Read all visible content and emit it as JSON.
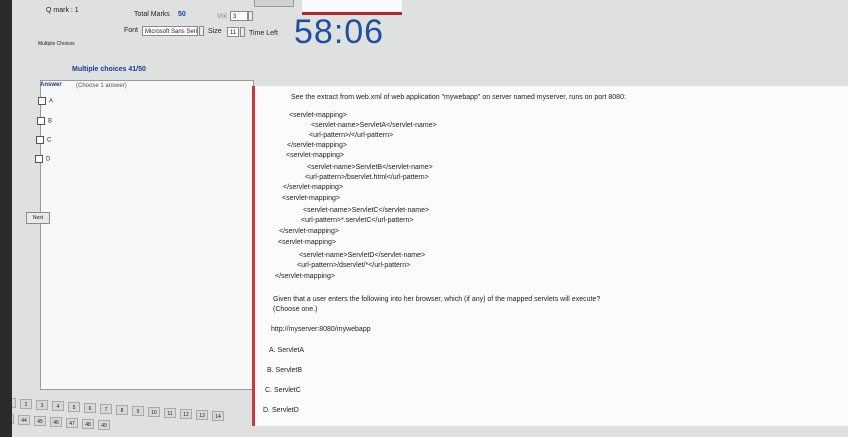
{
  "header": {
    "q_mark_label": "Q mark : 1",
    "total_marks_label": "Total Marks",
    "total_marks_value": "50",
    "vol_label": "Vol",
    "vol_value": "3",
    "font_label": "Font",
    "font_value": "Microsoft Sans Serif",
    "size_label": "Size",
    "size_value": "11",
    "time_left_label": "Time Left",
    "timer": "58:06",
    "mode_label": "Multiple Choices"
  },
  "question_panel_title": "Multiple choices 41/50",
  "answers": {
    "header": "Answer",
    "hint": "(Choose 1 answer)",
    "options": [
      "A",
      "B",
      "C",
      "D"
    ],
    "next_label": "Next"
  },
  "question": {
    "intro": "See the extract from web.xml of web application \"mywebapp\" on server named myserver, runs on port 8080:",
    "code": [
      "<servlet-mapping>",
      "<servlet-name>ServletA</servlet-name>",
      "<url-pattern>/</url-pattern>",
      "</servlet-mapping>",
      "<servlet-mapping>",
      "<servlet-name>ServletB</servlet-name>",
      "<url-pattern>/bservlet.html</url-pattern>",
      "</servlet-mapping>",
      "<servlet-mapping>",
      "<servlet-name>ServletC</servlet-name>",
      "<url-pattern>*.servletC</url-pattern>",
      "</servlet-mapping>",
      "<servlet-mapping>",
      "<servlet-name>ServletD</servlet-name>",
      "<url-pattern>/dservlet/*</url-pattern>",
      "</servlet-mapping>"
    ],
    "prompt": "Given that a user enters the following into her browser, which (if any) of the mapped servlets will execute?",
    "prompt_note": "(Choose one.)",
    "url": "http://myserver:8080/mywebapp",
    "choices": [
      "A. ServletA",
      "B. ServletB",
      "C. ServletC",
      "D. ServletD"
    ]
  },
  "pager": {
    "row1": [
      "1",
      "2",
      "3",
      "4",
      "5",
      "6",
      "7",
      "8",
      "9",
      "10",
      "11",
      "12",
      "13",
      "14"
    ],
    "row2": [
      "43",
      "44",
      "45",
      "46",
      "47",
      "48",
      "49"
    ]
  }
}
